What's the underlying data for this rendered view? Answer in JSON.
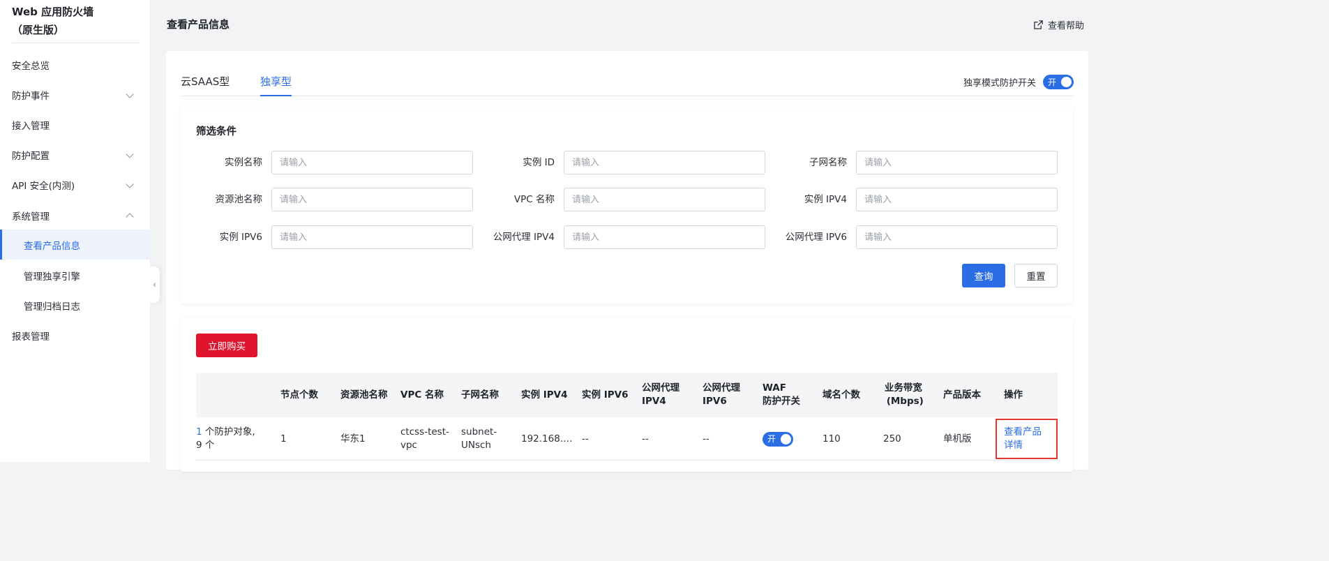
{
  "sidebar": {
    "brand_line1": "Web 应用防火墙",
    "brand_line2": "（原生版）",
    "items": [
      {
        "label": "安全总览"
      },
      {
        "label": "防护事件"
      },
      {
        "label": "接入管理"
      },
      {
        "label": "防护配置"
      },
      {
        "label": "API 安全(内测)"
      },
      {
        "label": "系统管理"
      },
      {
        "label": "查看产品信息"
      },
      {
        "label": "管理独享引擎"
      },
      {
        "label": "管理归档日志"
      },
      {
        "label": "报表管理"
      }
    ]
  },
  "header": {
    "title": "查看产品信息",
    "help": "查看帮助"
  },
  "tabs": [
    {
      "label": "云SAAS型"
    },
    {
      "label": "独享型"
    }
  ],
  "mode_switch": {
    "label": "独享模式防护开关",
    "state": "开"
  },
  "filter": {
    "title": "筛选条件",
    "placeholder": "请输入",
    "fields": [
      {
        "label": "实例名称"
      },
      {
        "label": "实例 ID"
      },
      {
        "label": "子网名称"
      },
      {
        "label": "资源池名称"
      },
      {
        "label": "VPC 名称"
      },
      {
        "label": "实例 IPV4"
      },
      {
        "label": "实例 IPV6"
      },
      {
        "label": "公网代理 IPV4"
      },
      {
        "label": "公网代理 IPV6"
      }
    ],
    "query_label": "查询",
    "reset_label": "重置"
  },
  "list": {
    "buy_label": "立即购买",
    "columns": [
      {
        "line1": "节点个数",
        "line2": ""
      },
      {
        "line1": "资源池名称",
        "line2": ""
      },
      {
        "line1": "VPC 名称",
        "line2": ""
      },
      {
        "line1": "子网名称",
        "line2": ""
      },
      {
        "line1": "实例 IPV4",
        "line2": ""
      },
      {
        "line1": "实例 IPV6",
        "line2": ""
      },
      {
        "line1": "公网代理",
        "line2": "IPV4"
      },
      {
        "line1": "公网代理",
        "line2": "IPV6"
      },
      {
        "line1": "WAF",
        "line2": "防护开关"
      },
      {
        "line1": "域名个数",
        "line2": ""
      },
      {
        "line1": "业务带宽",
        "line2": "(Mbps)"
      },
      {
        "line1": "产品版本",
        "line2": ""
      },
      {
        "line1": "操作",
        "line2": ""
      }
    ],
    "row": {
      "protect_num": "1",
      "protect_text": " 个防护对象,",
      "protect_line2": "9 个",
      "nodes": "1",
      "pool": "华东1",
      "vpc_line1": "ctcss-test-",
      "vpc_line2": "vpc",
      "subnet_line1": "subnet-",
      "subnet_line2": "UNsch",
      "ipv4": "192.168.…",
      "ipv6": "--",
      "proxy_ipv4": "--",
      "proxy_ipv6": "--",
      "waf_switch": "开",
      "domains": "110",
      "bandwidth": "250",
      "version": "单机版",
      "action": "查看产品详情"
    }
  }
}
